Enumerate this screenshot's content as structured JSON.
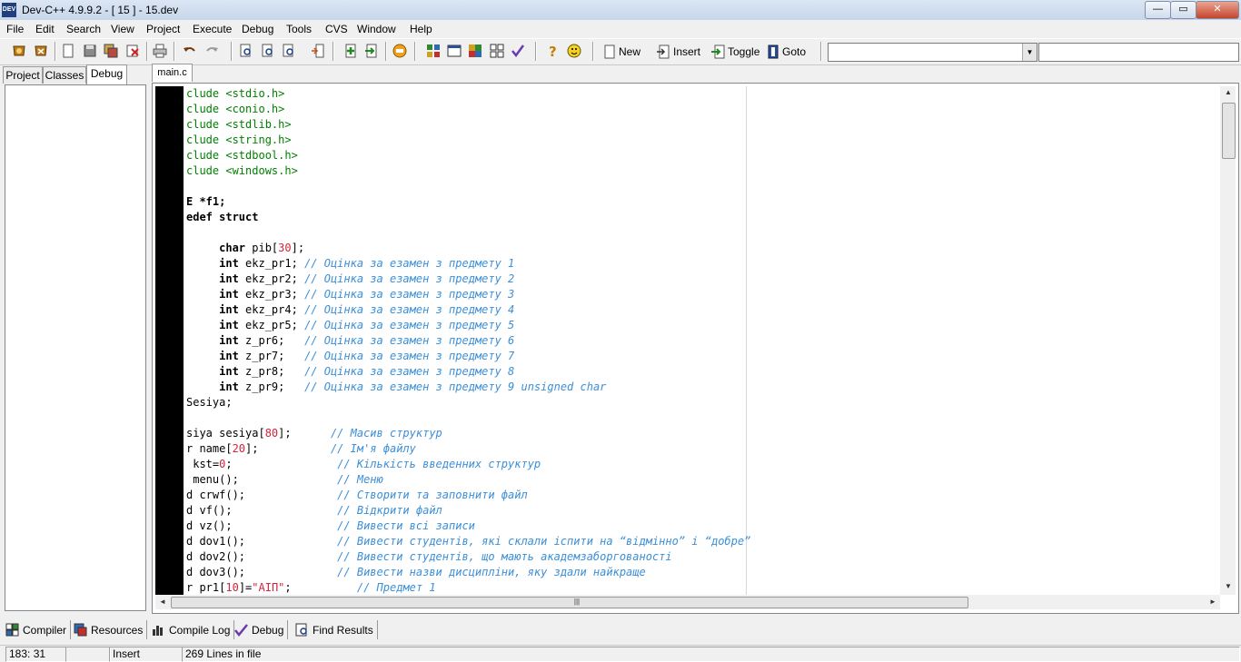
{
  "window": {
    "app_icon": "DEV",
    "title": "Dev-C++ 4.9.9.2  - [ 15 ] - 15.dev",
    "min_label": "—",
    "max_label": "▭",
    "close_label": "✕"
  },
  "menu": [
    "File",
    "Edit",
    "Search",
    "View",
    "Project",
    "Execute",
    "Debug",
    "Tools",
    "CVS",
    "Window",
    "Help"
  ],
  "toolbar": {
    "new_label": "New",
    "insert_label": "Insert",
    "toggle_label": "Toggle",
    "goto_label": "Goto",
    "combo1_value": "",
    "combo2_value": ""
  },
  "left_tabs": [
    "Project",
    "Classes",
    "Debug"
  ],
  "editor_tab": "main.c",
  "code_lines": [
    [
      {
        "t": "clude <stdio.h>",
        "c": "c-green"
      }
    ],
    [
      {
        "t": "clude <conio.h>",
        "c": "c-green"
      }
    ],
    [
      {
        "t": "clude <stdlib.h>",
        "c": "c-green"
      }
    ],
    [
      {
        "t": "clude <string.h>",
        "c": "c-green"
      }
    ],
    [
      {
        "t": "clude <stdbool.h>",
        "c": "c-green"
      }
    ],
    [
      {
        "t": "clude <windows.h>",
        "c": "c-green"
      }
    ],
    [
      {
        "t": ""
      }
    ],
    [
      {
        "t": "E *f1;",
        "c": "c-kw"
      }
    ],
    [
      {
        "t": "edef struct",
        "c": "c-kw"
      }
    ],
    [
      {
        "t": ""
      }
    ],
    [
      {
        "t": "     "
      },
      {
        "t": "char",
        "c": "c-kw"
      },
      {
        "t": " pib["
      },
      {
        "t": "30",
        "c": "c-num"
      },
      {
        "t": "];"
      }
    ],
    [
      {
        "t": "     "
      },
      {
        "t": "int",
        "c": "c-kw"
      },
      {
        "t": " ekz_pr1; "
      },
      {
        "t": "// Оцінка за езамен з предмету 1",
        "c": "c-comment"
      }
    ],
    [
      {
        "t": "     "
      },
      {
        "t": "int",
        "c": "c-kw"
      },
      {
        "t": " ekz_pr2; "
      },
      {
        "t": "// Оцінка за езамен з предмету 2",
        "c": "c-comment"
      }
    ],
    [
      {
        "t": "     "
      },
      {
        "t": "int",
        "c": "c-kw"
      },
      {
        "t": " ekz_pr3; "
      },
      {
        "t": "// Оцінка за езамен з предмету 3",
        "c": "c-comment"
      }
    ],
    [
      {
        "t": "     "
      },
      {
        "t": "int",
        "c": "c-kw"
      },
      {
        "t": " ekz_pr4; "
      },
      {
        "t": "// Оцінка за езамен з предмету 4",
        "c": "c-comment"
      }
    ],
    [
      {
        "t": "     "
      },
      {
        "t": "int",
        "c": "c-kw"
      },
      {
        "t": " ekz_pr5; "
      },
      {
        "t": "// Оцінка за езамен з предмету 5",
        "c": "c-comment"
      }
    ],
    [
      {
        "t": "     "
      },
      {
        "t": "int",
        "c": "c-kw"
      },
      {
        "t": " z_pr6;   "
      },
      {
        "t": "// Оцінка за езамен з предмету 6",
        "c": "c-comment"
      }
    ],
    [
      {
        "t": "     "
      },
      {
        "t": "int",
        "c": "c-kw"
      },
      {
        "t": " z_pr7;   "
      },
      {
        "t": "// Оцінка за езамен з предмету 7",
        "c": "c-comment"
      }
    ],
    [
      {
        "t": "     "
      },
      {
        "t": "int",
        "c": "c-kw"
      },
      {
        "t": " z_pr8;   "
      },
      {
        "t": "// Оцінка за езамен з предмету 8",
        "c": "c-comment"
      }
    ],
    [
      {
        "t": "     "
      },
      {
        "t": "int",
        "c": "c-kw"
      },
      {
        "t": " z_pr9;   "
      },
      {
        "t": "// Оцінка за езамен з предмету 9 unsigned char",
        "c": "c-comment"
      }
    ],
    [
      {
        "t": "Sesiya;"
      }
    ],
    [
      {
        "t": ""
      }
    ],
    [
      {
        "t": "siya sesiya["
      },
      {
        "t": "80",
        "c": "c-num"
      },
      {
        "t": "];      "
      },
      {
        "t": "// Масив структур",
        "c": "c-comment"
      }
    ],
    [
      {
        "t": "r name["
      },
      {
        "t": "20",
        "c": "c-num"
      },
      {
        "t": "];           "
      },
      {
        "t": "// Ім'я файлу",
        "c": "c-comment"
      }
    ],
    [
      {
        "t": " kst="
      },
      {
        "t": "0",
        "c": "c-num"
      },
      {
        "t": ";                "
      },
      {
        "t": "// Кількість введенних структур",
        "c": "c-comment"
      }
    ],
    [
      {
        "t": " menu();               "
      },
      {
        "t": "// Меню",
        "c": "c-comment"
      }
    ],
    [
      {
        "t": "d crwf();              "
      },
      {
        "t": "// Створити та заповнити файл",
        "c": "c-comment"
      }
    ],
    [
      {
        "t": "d vf();                "
      },
      {
        "t": "// Відкрити файл",
        "c": "c-comment"
      }
    ],
    [
      {
        "t": "d vz();                "
      },
      {
        "t": "// Вивести всі записи",
        "c": "c-comment"
      }
    ],
    [
      {
        "t": "d dov1();              "
      },
      {
        "t": "// Вивести студентів, які склали іспити на “відмінно” і “добре”",
        "c": "c-comment"
      }
    ],
    [
      {
        "t": "d dov2();              "
      },
      {
        "t": "// Вивести студентів, що мають академзаборгованості",
        "c": "c-comment"
      }
    ],
    [
      {
        "t": "d dov3();              "
      },
      {
        "t": "// Вивести назви дисципліни, яку здали найкраще",
        "c": "c-comment"
      }
    ],
    [
      {
        "t": "r pr1["
      },
      {
        "t": "10",
        "c": "c-num"
      },
      {
        "t": "]="
      },
      {
        "t": "\"АІП\"",
        "c": "c-str"
      },
      {
        "t": ";          "
      },
      {
        "t": "// Предмет 1",
        "c": "c-comment"
      }
    ]
  ],
  "scroll_arrows": {
    "up": "▲",
    "down": "▼",
    "left": "◄",
    "right": "►",
    "grip": "|||"
  },
  "bottom_tabs": [
    "Compiler",
    "Resources",
    "Compile Log",
    "Debug",
    "Find Results"
  ],
  "status": {
    "position": "183: 31",
    "blank": "",
    "mode": "Insert",
    "lines": "269 Lines in file"
  }
}
